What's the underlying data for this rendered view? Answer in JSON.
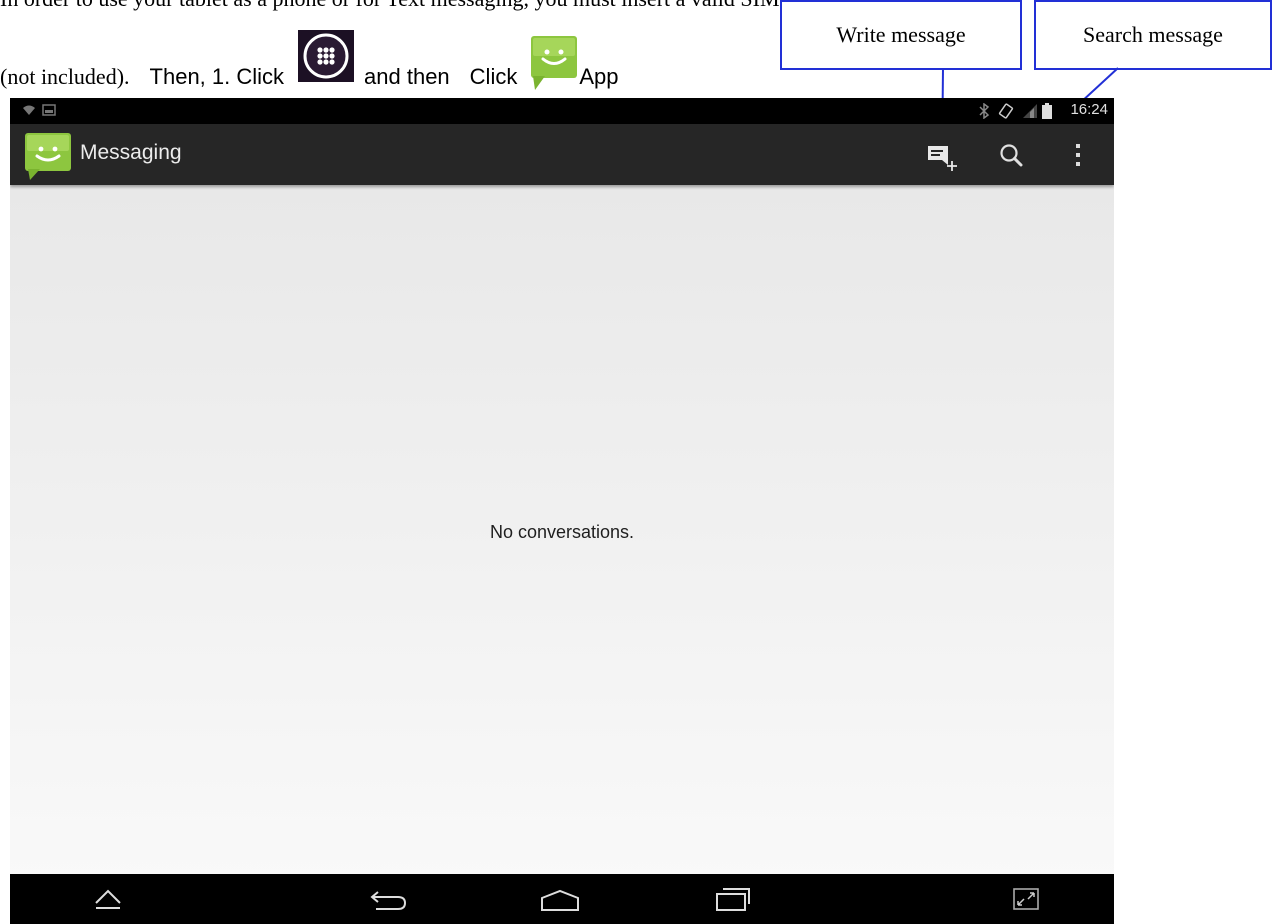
{
  "document": {
    "line1": "In order to use your tablet as a phone or for Text messaging, you must insert a valid SIM",
    "line2_part1": "(not included).",
    "line2_part2": "Then, 1. Click",
    "line2_part3": "and then",
    "line2_part4": "Click",
    "line2_part5": "App"
  },
  "callouts": {
    "write": "Write message",
    "search": "Search message",
    "line_color": "#2230d6"
  },
  "status_bar": {
    "time": "16:24"
  },
  "action_bar": {
    "title": "Messaging"
  },
  "content": {
    "empty_message": "No conversations."
  },
  "icons": {
    "app": "messaging-smiley-icon",
    "actions": [
      "write-message-icon",
      "search-icon",
      "overflow-menu-icon"
    ],
    "navigation": [
      "hide-icon",
      "back-icon",
      "home-icon",
      "recent-apps-icon",
      "screenshot-icon"
    ]
  },
  "colors": {
    "action_bar": "#262626",
    "status_bar": "#000000",
    "brand_green": "#8dc63f"
  }
}
